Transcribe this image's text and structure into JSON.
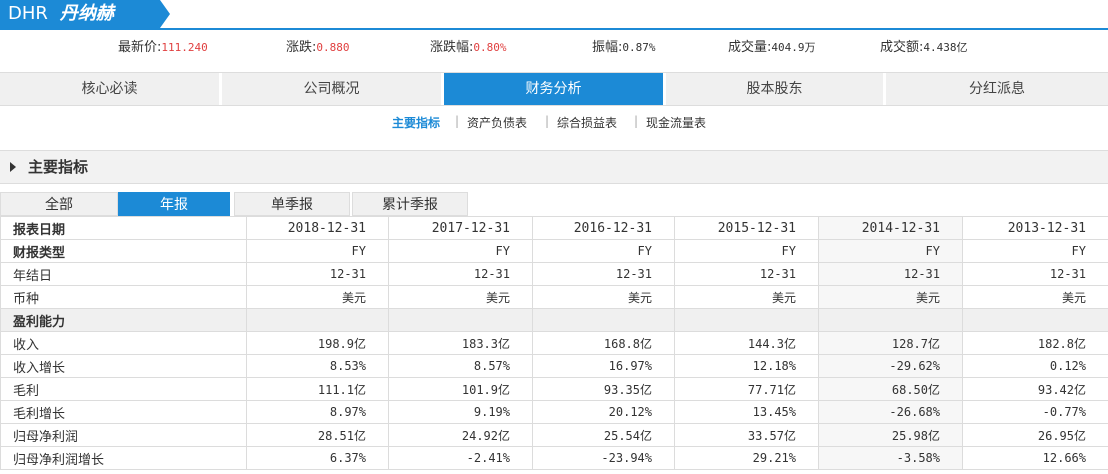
{
  "header": {
    "code": "DHR",
    "name": "丹纳赫"
  },
  "quote": {
    "latest_label": "最新价:",
    "latest_value": "111.240",
    "change_label": "涨跌:",
    "change_value": "0.880",
    "change_pct_label": "涨跌幅:",
    "change_pct_value": "0.80%",
    "amplitude_label": "振幅:",
    "amplitude_value": "0.87%",
    "volume_label": "成交量:",
    "volume_value": "404.9万",
    "turnover_label": "成交额:",
    "turnover_value": "4.438亿",
    "up_color": "#e04040"
  },
  "nav": {
    "tabs": [
      "核心必读",
      "公司概况",
      "财务分析",
      "股本股东",
      "分红派息"
    ],
    "active": "财务分析",
    "accent_color": "#1c8ad6"
  },
  "subnav": {
    "items": [
      "主要指标",
      "资产负债表",
      "综合损益表",
      "现金流量表"
    ],
    "active": "主要指标",
    "separator": "|"
  },
  "section": {
    "title": "主要指标"
  },
  "period_tabs": {
    "items": [
      "全部",
      "年报",
      "单季报",
      "累计季报"
    ],
    "active": "年报"
  },
  "table": {
    "header_label": "报表日期",
    "dates": [
      "2018-12-31",
      "2017-12-31",
      "2016-12-31",
      "2015-12-31",
      "2014-12-31",
      "2013-12-31"
    ],
    "rows": [
      {
        "label": "财报类型",
        "bold": true,
        "values": [
          "FY",
          "FY",
          "FY",
          "FY",
          "FY",
          "FY"
        ]
      },
      {
        "label": "年结日",
        "values": [
          "12-31",
          "12-31",
          "12-31",
          "12-31",
          "12-31",
          "12-31"
        ]
      },
      {
        "label": "币种",
        "values": [
          "美元",
          "美元",
          "美元",
          "美元",
          "美元",
          "美元"
        ]
      },
      {
        "label": "盈利能力",
        "group": true,
        "values": [
          "",
          "",
          "",
          "",
          "",
          ""
        ]
      },
      {
        "label": "收入",
        "values": [
          "198.9亿",
          "183.3亿",
          "168.8亿",
          "144.3亿",
          "128.7亿",
          "182.8亿"
        ]
      },
      {
        "label": "收入增长",
        "values": [
          "8.53%",
          "8.57%",
          "16.97%",
          "12.18%",
          "-29.62%",
          "0.12%"
        ]
      },
      {
        "label": "毛利",
        "values": [
          "111.1亿",
          "101.9亿",
          "93.35亿",
          "77.71亿",
          "68.50亿",
          "93.42亿"
        ]
      },
      {
        "label": "毛利增长",
        "values": [
          "8.97%",
          "9.19%",
          "20.12%",
          "13.45%",
          "-26.68%",
          "-0.77%"
        ]
      },
      {
        "label": "归母净利润",
        "values": [
          "28.51亿",
          "24.92亿",
          "25.54亿",
          "33.57亿",
          "25.98亿",
          "26.95亿"
        ]
      },
      {
        "label": "归母净利润增长",
        "values": [
          "6.37%",
          "-2.41%",
          "-23.94%",
          "29.21%",
          "-3.58%",
          "12.66%"
        ]
      }
    ]
  }
}
